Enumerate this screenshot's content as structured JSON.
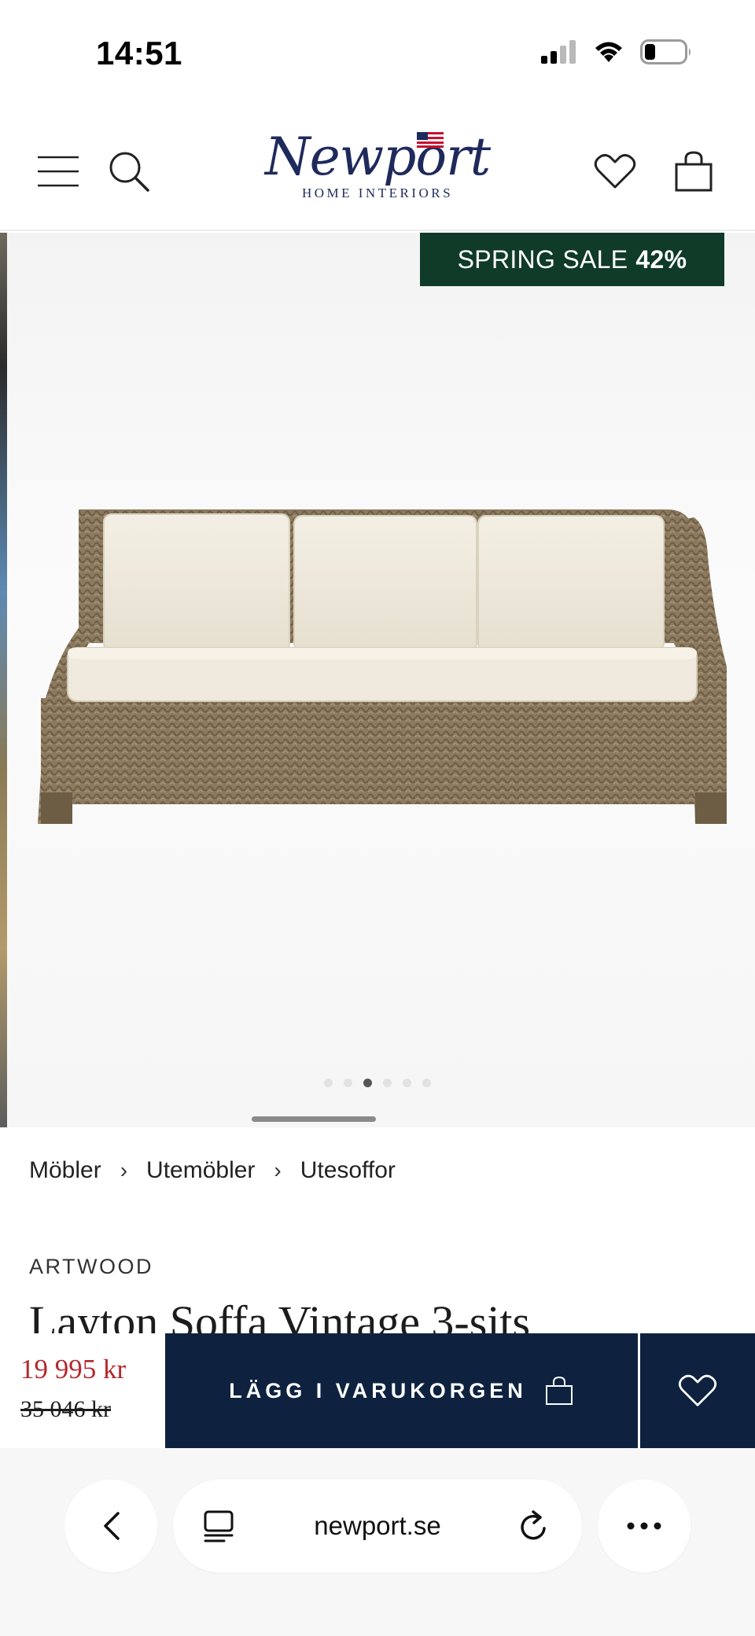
{
  "status_bar": {
    "time": "14:51",
    "icons": [
      "signal-icon",
      "wifi-icon",
      "battery-icon"
    ]
  },
  "header": {
    "logo": {
      "name": "Newport",
      "subtitle": "HOME INTERIORS"
    },
    "icons": [
      "menu-icon",
      "search-icon",
      "heart-icon",
      "bag-icon"
    ]
  },
  "gallery": {
    "badge_text": "SPRING SALE",
    "badge_percent": "42%",
    "badge_color": "#0f3b28",
    "dot_count": 6,
    "active_dot": 3
  },
  "breadcrumb": {
    "items": [
      "Möbler",
      "Utemöbler",
      "Utesoffor"
    ],
    "separator": "›"
  },
  "product": {
    "brand": "ARTWOOD",
    "title": "Layton Soffa Vintage 3-sits"
  },
  "buy_bar": {
    "price": "19 995 kr",
    "old_price": "35 046 kr",
    "add_to_cart": "LÄGG I VARUKORGEN",
    "price_color": "#b3282d",
    "button_color": "#0e2240"
  },
  "browser": {
    "url": "newport.se",
    "icons": [
      "back-icon",
      "tabs-icon",
      "reload-icon",
      "more-icon"
    ]
  }
}
